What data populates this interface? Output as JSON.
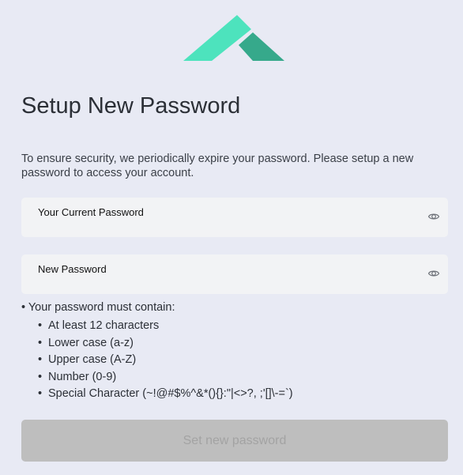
{
  "brand": {
    "logo_icon": "mountain-logo-icon",
    "colors": {
      "primary": "#4de3bd",
      "secondary": "#36a98b"
    }
  },
  "page": {
    "title": "Setup New Password",
    "description": "To ensure security, we periodically expire your password. Please setup a new password to access your account."
  },
  "fields": {
    "current_password": {
      "label": "Your Current Password",
      "value": "",
      "toggle_icon": "eye-icon"
    },
    "new_password": {
      "label": "New Password",
      "value": "",
      "toggle_icon": "eye-icon"
    }
  },
  "requirements": {
    "heading": "• Your password must contain:",
    "items": [
      "At least 12 characters",
      "Lower case (a-z)",
      "Upper case (A-Z)",
      "Number (0-9)",
      "Special Character (~!@#$%^&*(){}:\"|<>?, ;'[]\\-=`)"
    ]
  },
  "actions": {
    "submit_label": "Set new password",
    "submit_enabled": false
  }
}
